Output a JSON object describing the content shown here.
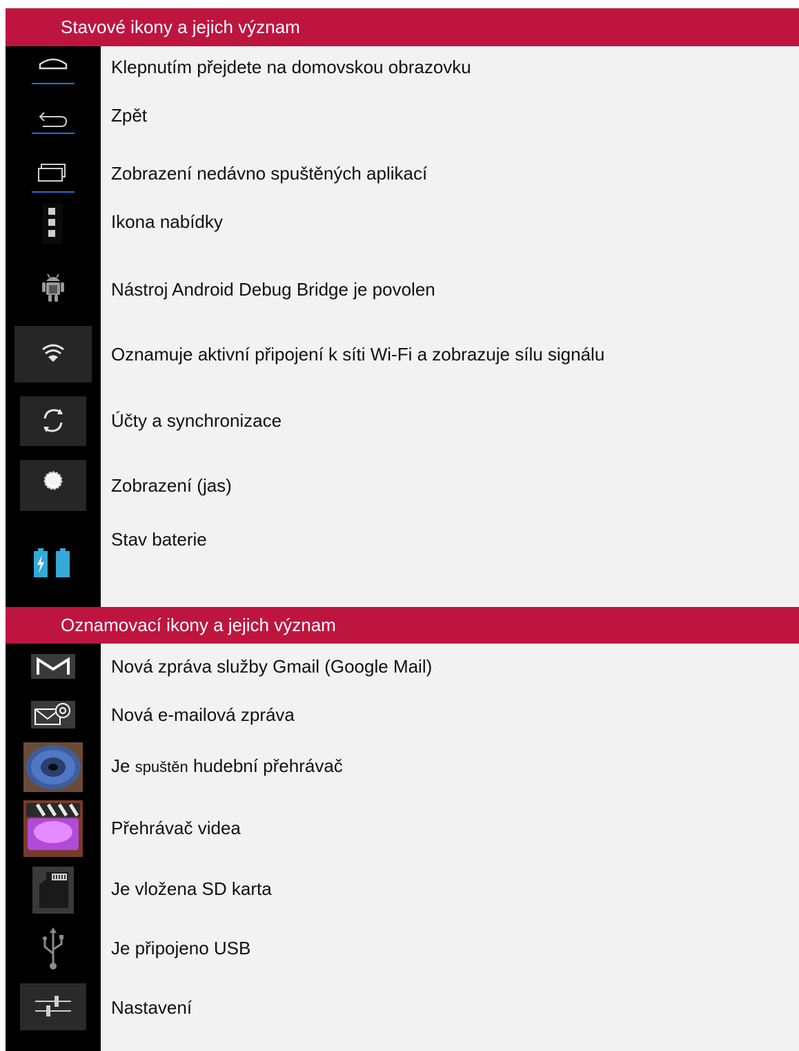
{
  "sections": [
    {
      "title": "Stavové ikony a jejich význam",
      "items": [
        {
          "icon": "home-icon",
          "label": "Klepnutím přejdete na domovskou obrazovku"
        },
        {
          "icon": "back-icon",
          "label": "Zpět"
        },
        {
          "icon": "recent-apps-icon",
          "label": "Zobrazení nedávno spuštěných aplikací"
        },
        {
          "icon": "menu-icon",
          "label": "Ikona nabídky"
        },
        {
          "icon": "android-debug-icon",
          "label": "Nástroj Android Debug Bridge je povolen"
        },
        {
          "icon": "wifi-icon",
          "label": "Oznamuje aktivní připojení k síti Wi-Fi a zobrazuje sílu signálu"
        },
        {
          "icon": "sync-icon",
          "label": "Účty a synchronizace"
        },
        {
          "icon": "brightness-icon",
          "label": "Zobrazení (jas)"
        },
        {
          "icon": "battery-icon",
          "label": "Stav baterie"
        }
      ]
    },
    {
      "title": "Oznamovací ikony a jejich význam",
      "items": [
        {
          "icon": "gmail-icon",
          "label": "Nová zpráva služby Gmail (Google Mail)"
        },
        {
          "icon": "email-icon",
          "label": "Nová e-mailová zpráva"
        },
        {
          "icon": "music-player-icon",
          "label_prefix": "Je ",
          "label_small": "spuštěn",
          "label_suffix": " hudební přehrávač"
        },
        {
          "icon": "video-player-icon",
          "label": "Přehrávač videa"
        },
        {
          "icon": "sd-card-icon",
          "label": "Je vložena SD karta"
        },
        {
          "icon": "usb-icon",
          "label": "Je připojeno USB"
        },
        {
          "icon": "settings-icon",
          "label": "Nastavení"
        }
      ]
    }
  ],
  "colors": {
    "header": "#be1540",
    "icon_column": "#000000",
    "text_column": "#f2f2f2",
    "accent_blue": "#1f6fd6",
    "battery_blue": "#35a8d8"
  }
}
